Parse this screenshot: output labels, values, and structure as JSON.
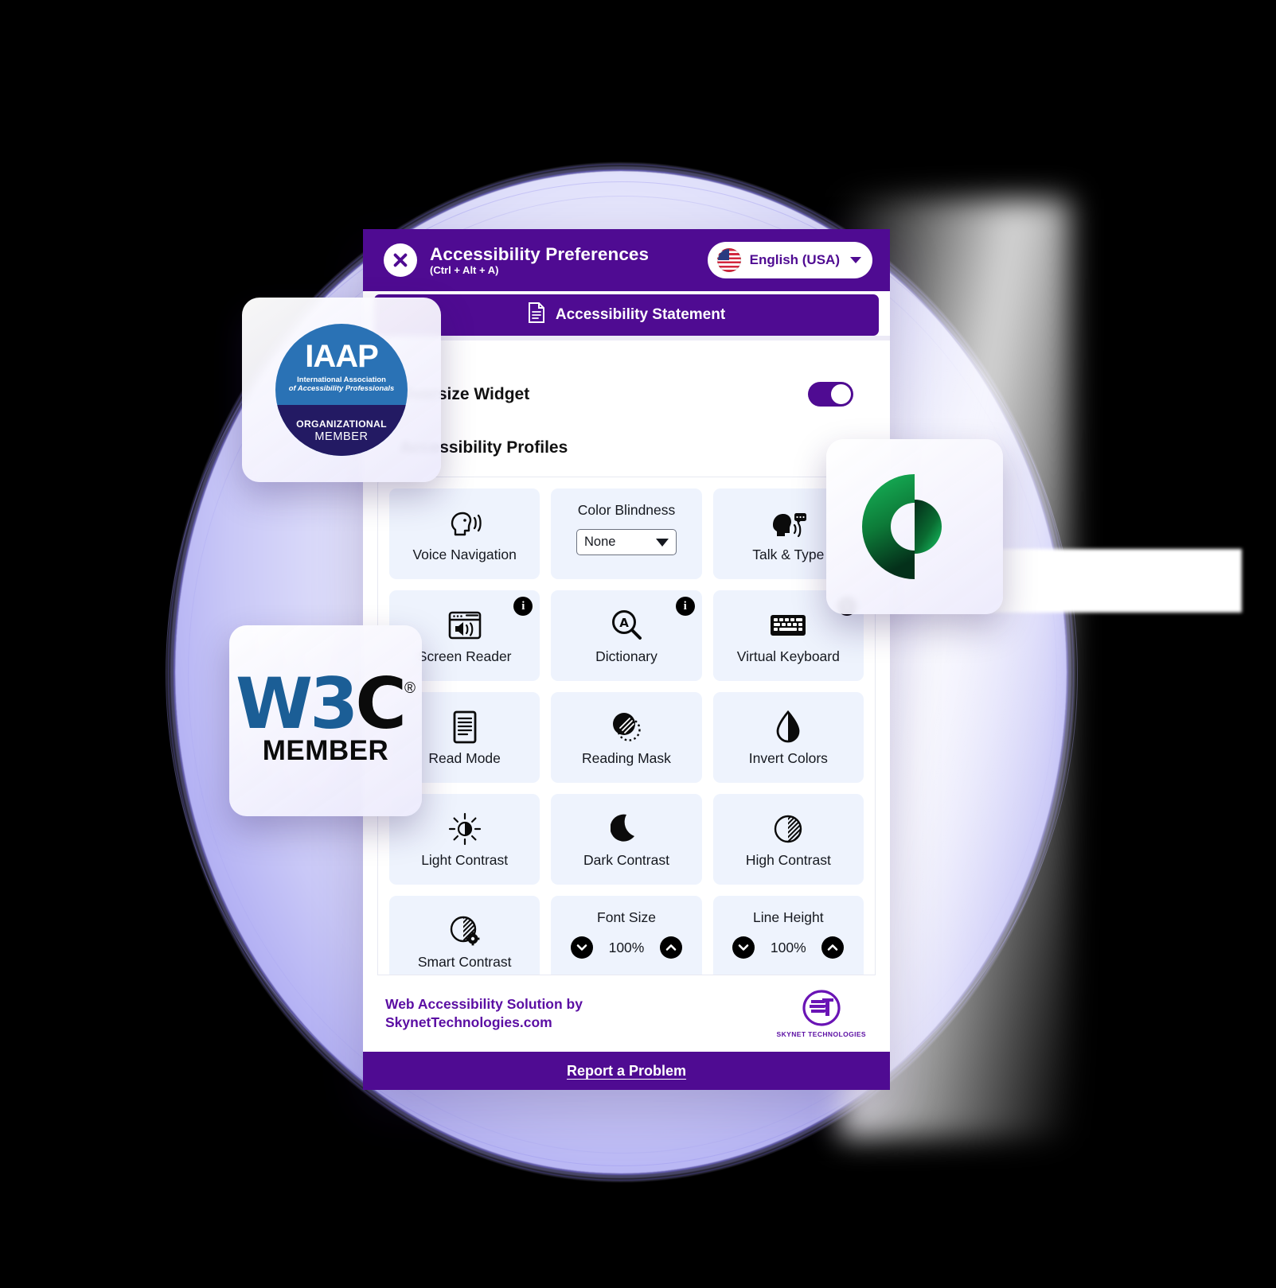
{
  "widget": {
    "header": {
      "title": "Accessibility Preferences",
      "shortcut": "(Ctrl + Alt + A)",
      "close_icon": "close-x-icon",
      "language": {
        "label": "English (USA)",
        "flag_icon": "us-flag-icon",
        "caret_icon": "chevron-down-icon"
      }
    },
    "statement": {
      "label": "Accessibility Statement",
      "icon": "document-icon"
    },
    "oversize": {
      "label": "Oversize Widget",
      "toggle_state": "on"
    },
    "profiles": {
      "label": "Accessibility Profiles"
    },
    "tiles": [
      {
        "type": "action",
        "label": "Voice Navigation",
        "icon": "head-speaking-icon",
        "info": false
      },
      {
        "type": "select",
        "label": "Color Blindness",
        "value": "None",
        "info": false
      },
      {
        "type": "action",
        "label": "Talk & Type",
        "icon": "head-talk-type-icon",
        "info": false
      },
      {
        "type": "action",
        "label": "Screen Reader",
        "icon": "screen-reader-icon",
        "info": true
      },
      {
        "type": "action",
        "label": "Dictionary",
        "icon": "dictionary-icon",
        "info": true
      },
      {
        "type": "action",
        "label": "Virtual Keyboard",
        "icon": "keyboard-icon",
        "info": true
      },
      {
        "type": "action",
        "label": "Read Mode",
        "icon": "read-mode-icon",
        "info": false
      },
      {
        "type": "action",
        "label": "Reading Mask",
        "icon": "reading-mask-icon",
        "info": false
      },
      {
        "type": "action",
        "label": "Invert Colors",
        "icon": "invert-colors-icon",
        "info": false
      },
      {
        "type": "action",
        "label": "Light Contrast",
        "icon": "sun-icon",
        "info": false
      },
      {
        "type": "action",
        "label": "Dark Contrast",
        "icon": "moon-icon",
        "info": false
      },
      {
        "type": "action",
        "label": "High Contrast",
        "icon": "high-contrast-icon",
        "info": false
      },
      {
        "type": "action",
        "label": "Smart Contrast",
        "icon": "smart-contrast-icon",
        "info": false
      },
      {
        "type": "stepper",
        "label": "Font Size",
        "value": "100%",
        "info": false
      },
      {
        "type": "stepper",
        "label": "Line Height",
        "value": "100%",
        "info": false
      }
    ],
    "footer": {
      "line1": "Web Accessibility Solution by",
      "line2": "SkynetTechnologies.com",
      "logo_text": "ST",
      "logo_name": "SKYNET TECHNOLOGIES"
    },
    "report": {
      "label": "Report a Problem"
    }
  },
  "badges": {
    "iaap": {
      "acronym": "IAAP",
      "line1": "International Association",
      "line2": "of Accessibility Professionals",
      "tier1": "ORGANIZATIONAL",
      "tier2": "MEMBER"
    },
    "w3c": {
      "w3": "W3",
      "c": "C",
      "registered": "®",
      "member": "MEMBER"
    },
    "green": {
      "icon": "green-crescent-logo"
    }
  },
  "colors": {
    "purple": "#4f0b92",
    "purple_text": "#5b0ea3",
    "tile_bg": "#eef3fd",
    "iaap_blue": "#2a72b5",
    "iaap_navy": "#231a63",
    "w3c_blue": "#1b5e96",
    "green_light": "#12a84f",
    "green_dark": "#073a1b"
  }
}
